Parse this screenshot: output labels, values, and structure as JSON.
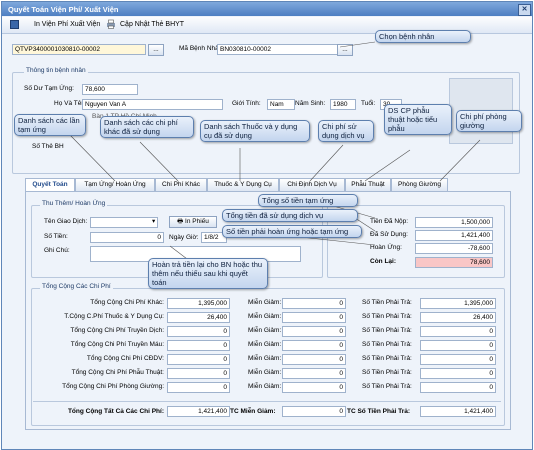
{
  "window": {
    "title": "Quyết Toán Viện Phí/ Xuất Viện"
  },
  "toolbar": {
    "print_invoice": "In Viện Phí Xuất Viện",
    "update_card": "Cập Nhật Thẻ BHYT"
  },
  "header": {
    "record_code": "QTVP3400001030810-00002",
    "patient_code_label": "Mã Bệnh Nhân:",
    "patient_code": "BN030810-00002",
    "browse1": "...",
    "browse2": "..."
  },
  "patient_info": {
    "title": "Thông tin bệnh nhân",
    "deposit_label": "Số Dư Tạm Ứng:",
    "deposit": "78,600",
    "name_label": "Họ Và Tên:",
    "name": "Nguyen Van A",
    "gender_label": "Giới Tính:",
    "gender": "Nam",
    "birth_year_label": "Năm Sinh:",
    "birth_year": "1980",
    "age_label": "Tuổi:",
    "age": "30",
    "address_fragment": "Bàn 1 TP Hồ Chí Minh",
    "card_label": "Số Thẻ BH"
  },
  "tabs": [
    "Quyết Toán",
    "Tạm Ứng/ Hoàn Ứng",
    "Chi Phí Khác",
    "Thuốc & Y Dụng Cụ",
    "Chi Định Dịch Vụ",
    "Phẫu Thuật",
    "Phòng Giường"
  ],
  "refund": {
    "title": "Thu Thêm/ Hoàn Ứng",
    "payer_label": "Tên Giao Dịch:",
    "print_btn": "In Phiếu",
    "amount_label": "Số Tiền:",
    "amount": "0",
    "date_label": "Ngày Giờ:",
    "date": "1/8/2",
    "note_label": "Ghi Chú:"
  },
  "summary": {
    "paid_label": "Tiền Đã Nộp:",
    "paid": "1,500,000",
    "used_label": "Đã Sử Dụng:",
    "used": "1,421,400",
    "refund_label": "Hoàn Ứng:",
    "refund": "-78,600",
    "remain_label": "Còn Lại:",
    "remain": "78,600"
  },
  "costs": {
    "title": "Tổng Cộng Các Chi Phí",
    "exempt_label": "Miễn Giảm:",
    "payable_label": "Số Tiền Phải Trả:",
    "rows": [
      {
        "label": "Tổng Cộng Chi Phí Khác:",
        "value": "1,395,000",
        "exempt": "0",
        "payable": "1,395,000"
      },
      {
        "label": "T.Cộng C.Phí Thuốc & Y Dụng Cụ:",
        "value": "26,400",
        "exempt": "0",
        "payable": "26,400"
      },
      {
        "label": "Tổng Cộng Chi Phí Truyền Dịch:",
        "value": "0",
        "exempt": "0",
        "payable": "0"
      },
      {
        "label": "Tổng Cộng Chi Phí Truyền Máu:",
        "value": "0",
        "exempt": "0",
        "payable": "0"
      },
      {
        "label": "Tổng Cộng Chi Phí CĐDV:",
        "value": "0",
        "exempt": "0",
        "payable": "0"
      },
      {
        "label": "Tổng Cộng Chi Phí Phẫu Thuật:",
        "value": "0",
        "exempt": "0",
        "payable": "0"
      },
      {
        "label": "Tổng Cộng Chi Phí Phòng Giường:",
        "value": "0",
        "exempt": "0",
        "payable": "0"
      }
    ],
    "total_label": "Tổng Cộng Tất Cả Các Chi Phí:",
    "total": "1,421,400",
    "total_exempt_label": "TC Miễn Giảm:",
    "total_exempt": "0",
    "total_payable_label": "TC Số Tiền Phải Trả:",
    "total_payable": "1,421,400"
  },
  "callouts": {
    "choose_patient": "Chọn bệnh nhân",
    "deposit_list": "Danh sách các lần tạm ứng",
    "other_costs": "Danh sách các chi phí khác đã sử dụng",
    "drugs": "Danh sách Thuốc và y dụng cụ đã sử dụng",
    "services": "Chi phí sử dụng dịch vụ",
    "surgery": "DS CP phẫu thuật hoặc tiểu phẫu",
    "room": "Chi phí phòng giường",
    "total_deposit": "Tổng số tiền tạm ứng",
    "total_used": "Tổng tiền đã sử dụng dịch vụ",
    "must_refund": "Số tiền phải hoàn ứng hoặc tạm ứng",
    "refund_note": "Hoàn trả tiền lại cho BN hoặc thu thêm nếu thiếu sau khi quyết toán"
  },
  "colors": {
    "titlebar": "#4e7fc2",
    "accent": "#234c8c",
    "remain_bg": "#f9c6c6",
    "code_bg": "#fff7d9"
  }
}
